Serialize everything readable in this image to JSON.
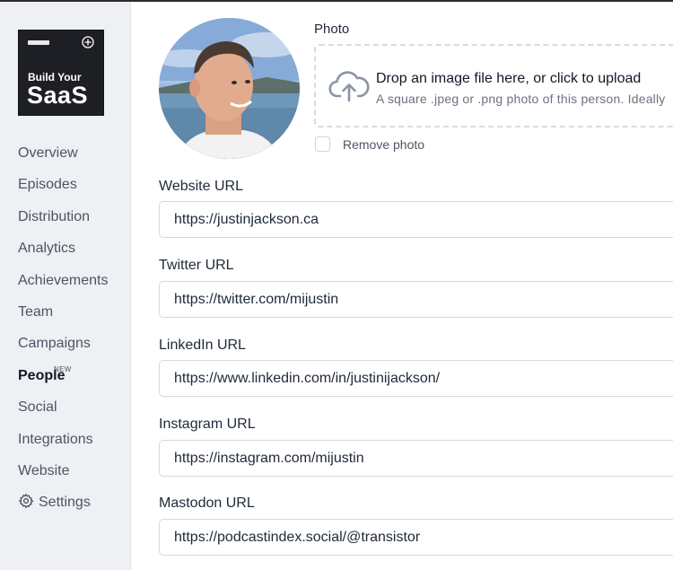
{
  "sidebar": {
    "podcast_cover": {
      "line1": "Build Your",
      "line2": "SaaS",
      "plus_icon": "plus-circle-icon"
    },
    "nav": [
      {
        "label": "Overview"
      },
      {
        "label": "Episodes"
      },
      {
        "label": "Distribution"
      },
      {
        "label": "Analytics"
      },
      {
        "label": "Achievements"
      },
      {
        "label": "Team"
      },
      {
        "label": "Campaigns"
      },
      {
        "label": "People",
        "badge": "NEW",
        "active": true
      },
      {
        "label": "Social"
      },
      {
        "label": "Integrations"
      },
      {
        "label": "Website"
      },
      {
        "label": "Settings",
        "icon": "gear-icon"
      }
    ]
  },
  "photo": {
    "label": "Photo",
    "upload_icon": "cloud-upload-icon",
    "drop_title": "Drop an image file here, or click to upload",
    "drop_subtitle": "A square .jpeg or .png photo of this person. Ideally",
    "remove_label": "Remove photo",
    "remove_checked": false
  },
  "fields": [
    {
      "label": "Website URL",
      "value": "https://justinjackson.ca"
    },
    {
      "label": "Twitter URL",
      "value": "https://twitter.com/mijustin"
    },
    {
      "label": "LinkedIn URL",
      "value": "https://www.linkedin.com/in/justinijackson/"
    },
    {
      "label": "Instagram URL",
      "value": "https://instagram.com/mijustin"
    },
    {
      "label": "Mastodon URL",
      "value": "https://podcastindex.social/@transistor"
    }
  ],
  "colors": {
    "sidebar_bg": "#eef0f4",
    "text_primary": "#1f2937",
    "text_muted": "#4b5563"
  }
}
